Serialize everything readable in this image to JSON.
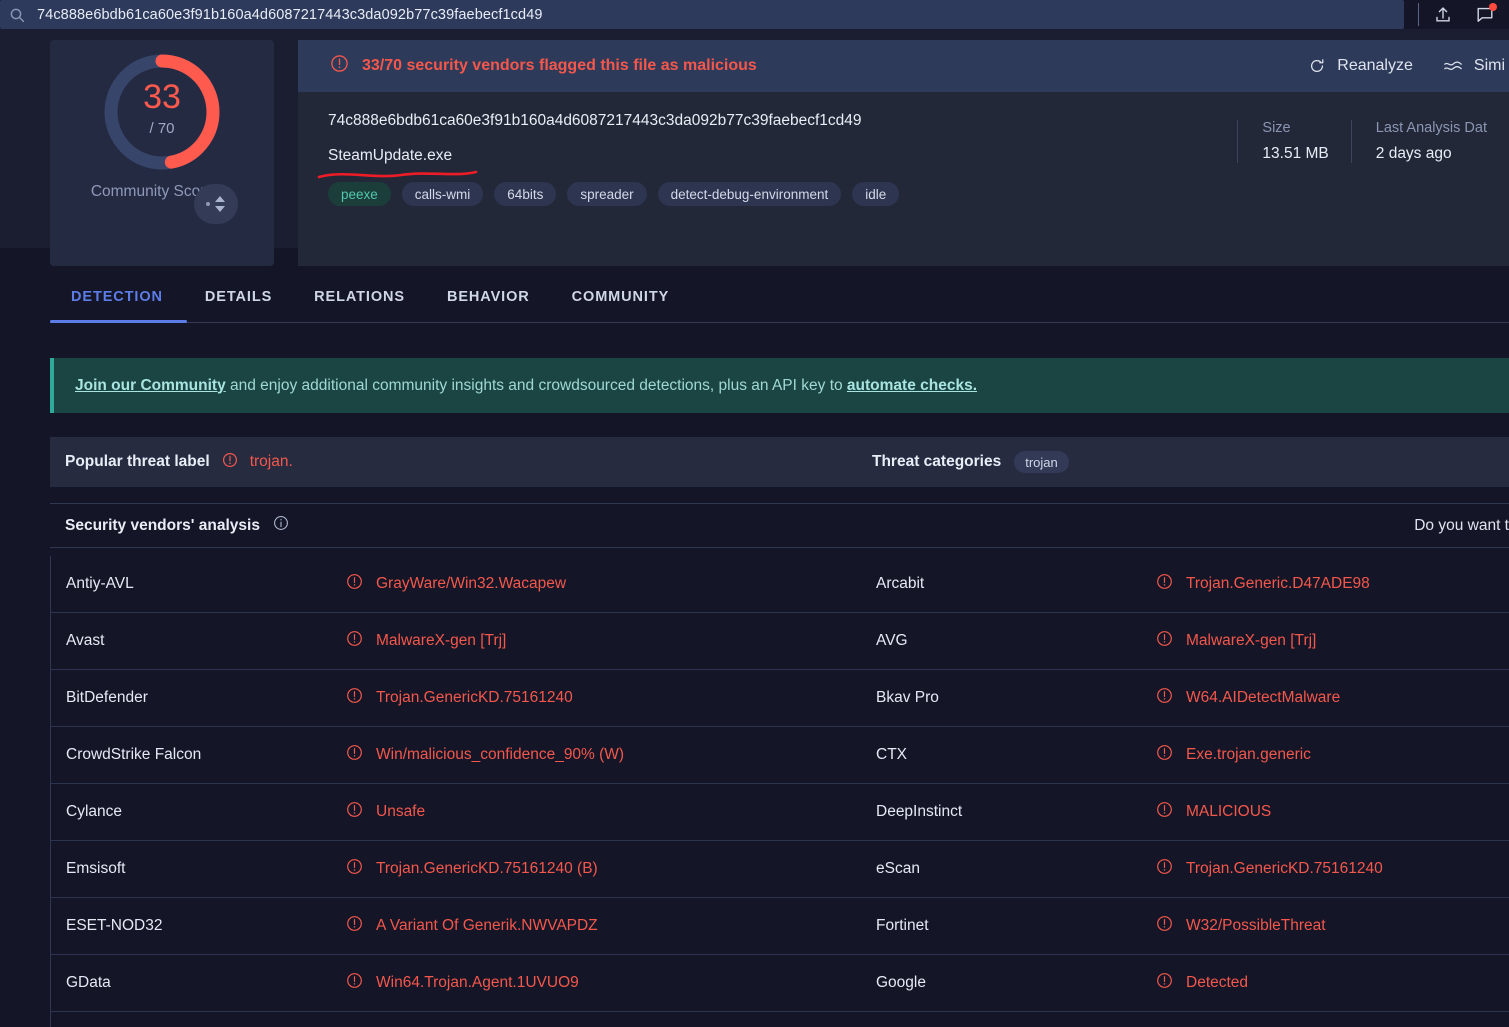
{
  "search": {
    "value": "74c888e6bdb61ca60e3f91b160a4d6087217443c3da092b77c39faebecf1cd49",
    "icon": "search-icon"
  },
  "topbar": {
    "upload_icon": "upload-icon",
    "comments_icon": "comment-icon",
    "has_notification": true
  },
  "score": {
    "detections": "33",
    "total": "/ 70",
    "ratio_percent": 47,
    "community_score_label": "Community Score",
    "color_detection": "#ff5a4e",
    "color_track": "#38456b"
  },
  "alert": {
    "icon": "exclamation-circle-icon",
    "text": "33/70 security vendors flagged this file as malicious",
    "color": "#f4574b"
  },
  "actions": {
    "reanalyze_label": "Reanalyze",
    "reanalyze_icon": "refresh-icon",
    "similar_label": "Simi",
    "similar_icon": "wave-icon"
  },
  "file": {
    "hash": "74c888e6bdb61ca60e3f91b160a4d6087217443c3da092b77c39faebecf1cd49",
    "name": "SteamUpdate.exe",
    "tags": [
      {
        "label": "peexe",
        "style": "green"
      },
      {
        "label": "calls-wmi",
        "style": "default"
      },
      {
        "label": "64bits",
        "style": "default"
      },
      {
        "label": "spreader",
        "style": "default"
      },
      {
        "label": "detect-debug-environment",
        "style": "default"
      },
      {
        "label": "idle",
        "style": "default"
      }
    ],
    "meta": [
      {
        "label": "Size",
        "value": "13.51 MB"
      },
      {
        "label": "Last Analysis Dat",
        "value": "2 days ago"
      }
    ],
    "annotation_color": "#ee1c26"
  },
  "tabs": [
    {
      "label": "DETECTION",
      "active": true
    },
    {
      "label": "DETAILS",
      "active": false
    },
    {
      "label": "RELATIONS",
      "active": false
    },
    {
      "label": "BEHAVIOR",
      "active": false
    },
    {
      "label": "COMMUNITY",
      "active": false
    }
  ],
  "banner": {
    "link1": "Join our Community",
    "mid": " and enjoy additional community insights and crowdsourced detections, plus an API key to ",
    "link2": "automate checks.",
    "accent": "#2ea99a"
  },
  "threat": {
    "label_title": "Popular threat label",
    "label_icon": "exclamation-circle-icon",
    "label_value": "trojan.",
    "categories_title": "Threat categories",
    "categories": [
      "trojan"
    ]
  },
  "vendors_section": {
    "title": "Security vendors' analysis",
    "info_icon": "info-circle-icon",
    "right_text": "Do you want t"
  },
  "vendors": [
    {
      "name": "Antiy-AVL",
      "result": "GrayWare/Win32.Wacapew",
      "name2": "Arcabit",
      "result2": "Trojan.Generic.D47ADE98"
    },
    {
      "name": "Avast",
      "result": "MalwareX-gen [Trj]",
      "name2": "AVG",
      "result2": "MalwareX-gen [Trj]"
    },
    {
      "name": "BitDefender",
      "result": "Trojan.GenericKD.75161240",
      "name2": "Bkav Pro",
      "result2": "W64.AIDetectMalware"
    },
    {
      "name": "CrowdStrike Falcon",
      "result": "Win/malicious_confidence_90% (W)",
      "name2": "CTX",
      "result2": "Exe.trojan.generic"
    },
    {
      "name": "Cylance",
      "result": "Unsafe",
      "name2": "DeepInstinct",
      "result2": "MALICIOUS"
    },
    {
      "name": "Emsisoft",
      "result": "Trojan.GenericKD.75161240 (B)",
      "name2": "eScan",
      "result2": "Trojan.GenericKD.75161240"
    },
    {
      "name": "ESET-NOD32",
      "result": "A Variant Of Generik.NWVAPDZ",
      "name2": "Fortinet",
      "result2": "W32/PossibleThreat"
    },
    {
      "name": "GData",
      "result": "Win64.Trojan.Agent.1UVUO9",
      "name2": "Google",
      "result2": "Detected"
    }
  ]
}
